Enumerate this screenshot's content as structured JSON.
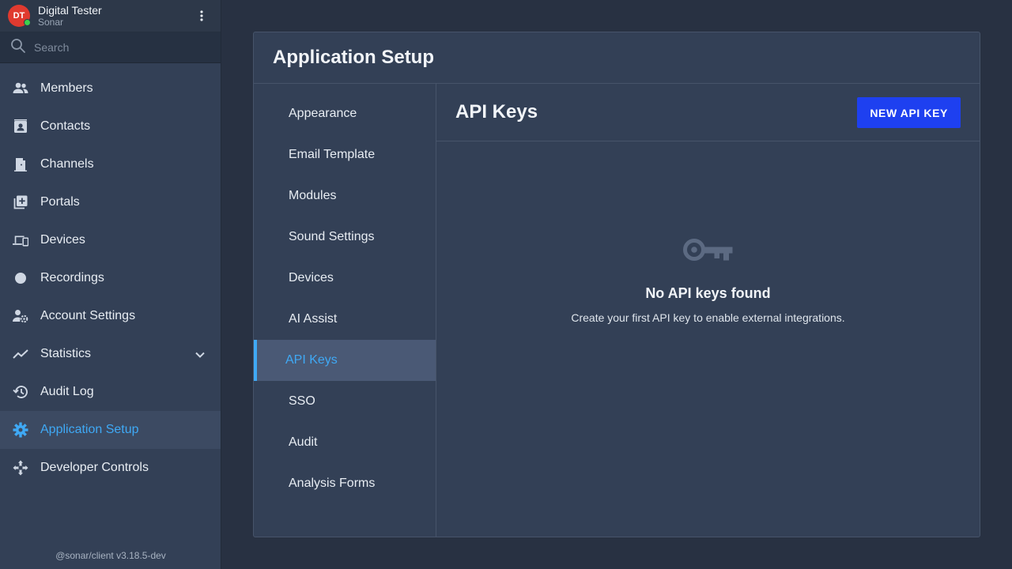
{
  "user": {
    "initials": "DT",
    "name": "Digital Tester",
    "org": "Sonar",
    "status_color": "#3ecf4e"
  },
  "search": {
    "placeholder": "Search"
  },
  "sidebar": {
    "items": [
      {
        "label": "Members",
        "icon": "members-icon"
      },
      {
        "label": "Contacts",
        "icon": "contacts-icon"
      },
      {
        "label": "Channels",
        "icon": "channels-icon"
      },
      {
        "label": "Portals",
        "icon": "portals-icon"
      },
      {
        "label": "Devices",
        "icon": "devices-icon"
      },
      {
        "label": "Recordings",
        "icon": "recordings-icon"
      },
      {
        "label": "Account Settings",
        "icon": "account-settings-icon"
      },
      {
        "label": "Statistics",
        "icon": "statistics-icon"
      },
      {
        "label": "Audit Log",
        "icon": "audit-log-icon"
      },
      {
        "label": "Application Setup",
        "icon": "gear-icon",
        "active": true
      },
      {
        "label": "Developer Controls",
        "icon": "developer-controls-icon"
      }
    ],
    "version": "@sonar/client v3.18.5-dev"
  },
  "panel": {
    "title": "Application Setup",
    "subnav": [
      "Appearance",
      "Email Template",
      "Modules",
      "Sound Settings",
      "Devices",
      "AI Assist",
      "API Keys",
      "SSO",
      "Audit",
      "Analysis Forms"
    ],
    "active_subnav": "API Keys"
  },
  "content": {
    "title": "API Keys",
    "new_button_label": "NEW API KEY",
    "empty_icon": "key-icon",
    "empty_title": "No API keys found",
    "empty_description": "Create your first API key to enable external integrations."
  },
  "colors": {
    "accent": "#3fa9f5",
    "primary_button": "#1e40f0",
    "background": "#283142",
    "sidebar": "#334056"
  }
}
